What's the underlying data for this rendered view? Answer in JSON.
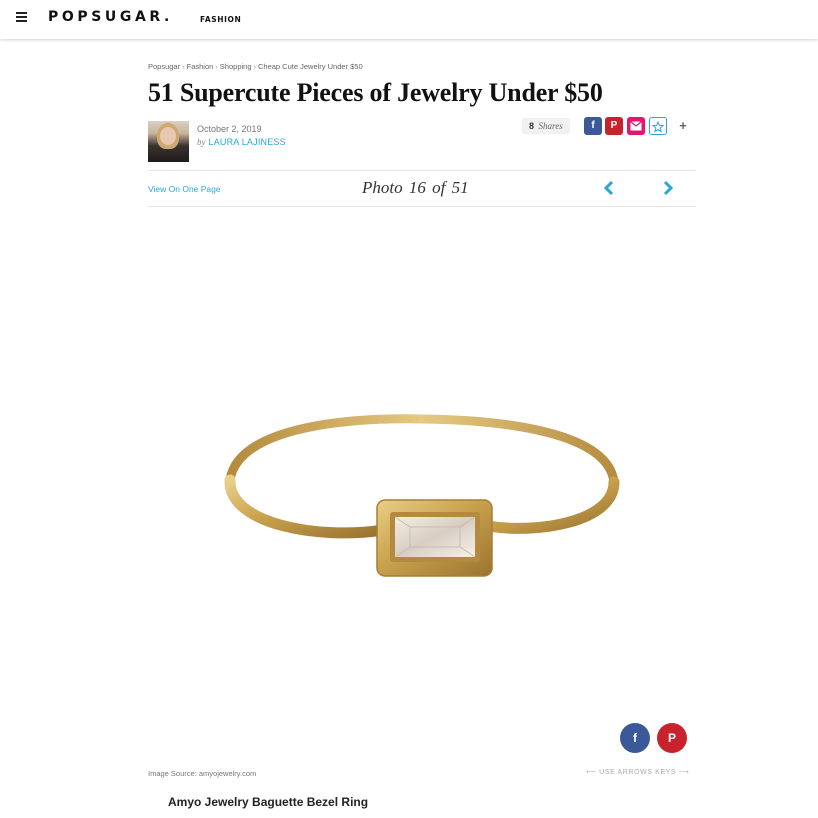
{
  "header": {
    "logo": "POPSUGAR.",
    "section": "FASHION"
  },
  "breadcrumb": [
    "Popsugar",
    "Fashion",
    "Shopping",
    "Cheap Cute Jewelry Under $50"
  ],
  "article": {
    "title": "51 Supercute Pieces of Jewelry Under $50",
    "date": "October 2, 2019",
    "by": "by",
    "author": "LAURA LAJINESS"
  },
  "share": {
    "count": "8",
    "label": "Shares",
    "more": "+"
  },
  "gallery": {
    "view_one_page": "View On One Page",
    "photo_word": "Photo",
    "current": "16",
    "of_word": "of",
    "total": "51"
  },
  "image": {
    "source": "Image Source: amyojewelry.com",
    "arrows_hint": "⟵ USE ARROWS KEYS ⟶",
    "caption": "Amyo Jewelry Baguette Bezel Ring"
  },
  "colors": {
    "accent": "#29a8d6",
    "facebook": "#3b5998",
    "pinterest": "#c8232c",
    "email": "#e4156e",
    "ring_gold": "#c9a24e"
  }
}
